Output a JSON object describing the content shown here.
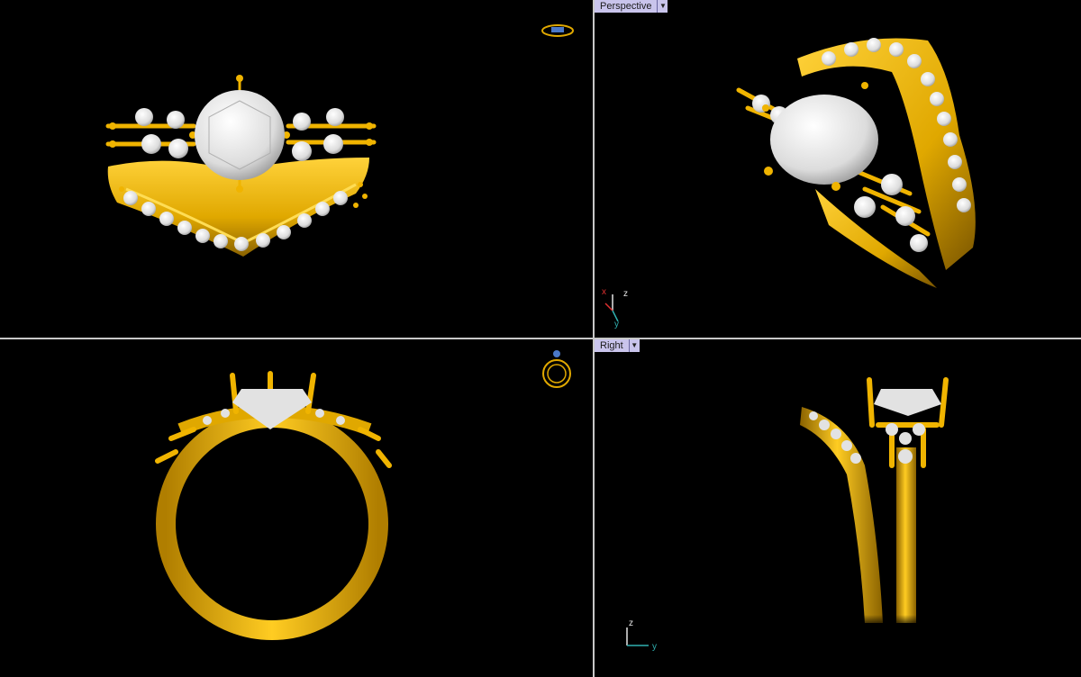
{
  "viewports": {
    "top": {
      "label": ""
    },
    "perspective": {
      "label": "Perspective",
      "menu_icon": "chevron-down-icon"
    },
    "front": {
      "label": ""
    },
    "right": {
      "label": "Right",
      "menu_icon": "chevron-down-icon"
    }
  },
  "axes": {
    "perspective": {
      "z": "z",
      "x": "x",
      "y": "y"
    },
    "right": {
      "z": "z",
      "y": "y"
    }
  },
  "colors": {
    "background": "#000000",
    "metal": "#e0a800",
    "metal_dark": "#8a6200",
    "stone": "#e8e8e8",
    "splitter": "#c8c8c8",
    "label_bg": "#c9c4ec",
    "axis_x": "#e03030",
    "axis_y": "#30b0b0",
    "axis_z": "#e6e6e6"
  }
}
